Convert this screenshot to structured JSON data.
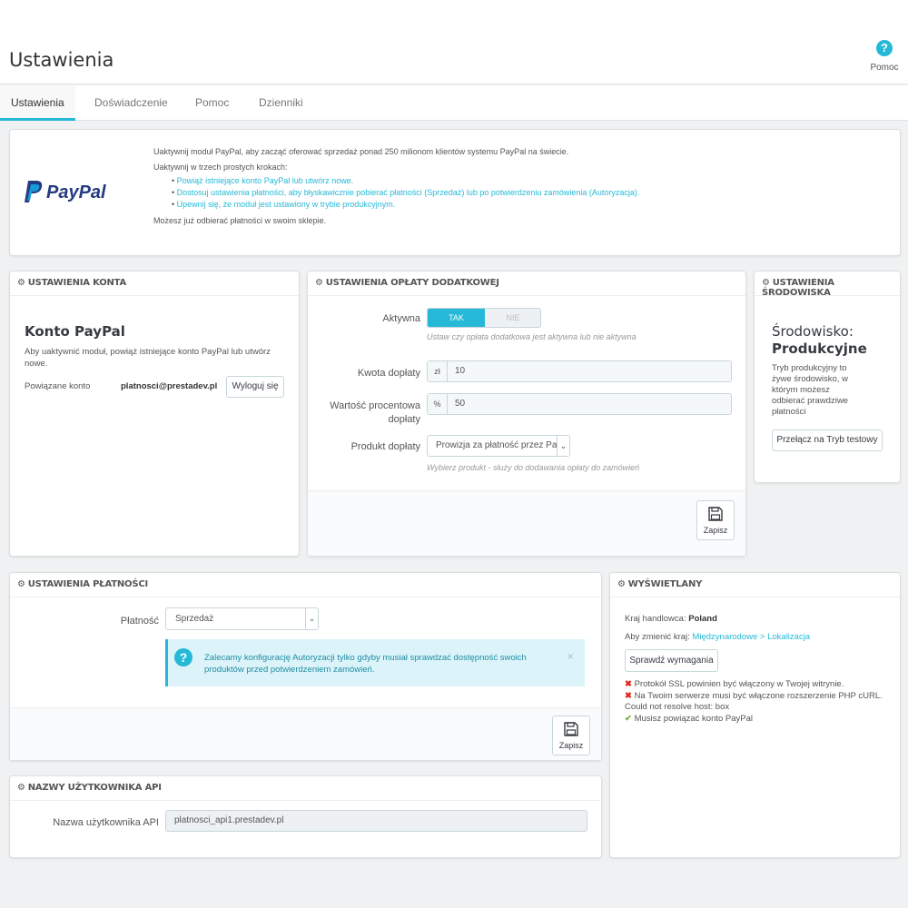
{
  "header": {
    "title": "Ustawienia",
    "help_label": "Pomoc",
    "help_icon": "question-circle-icon"
  },
  "tabs": [
    {
      "label": "Ustawienia",
      "active": true
    },
    {
      "label": "Doświadczenie"
    },
    {
      "label": "Pomoc"
    },
    {
      "label": "Dzienniki"
    }
  ],
  "intro": {
    "logo_text": "PayPal",
    "line1": "Uaktywnij moduł PayPal, aby zacząć oferować sprzedaż ponad 250 milionom klientów systemu PayPal na świecie.",
    "line2": "Uaktywnij w trzech prostych krokach:",
    "steps": [
      "Powiąż istniejące konto PayPal lub utwórz nowe.",
      "Dostosuj ustawienia płatności, aby błyskawicznie pobierać płatności (Sprzedaż) lub po potwierdzeniu zamówienia (Autoryzacja).",
      "Upewnij się, że moduł jest ustawiony w trybie produkcyjnym."
    ],
    "line3": "Możesz już odbierać płatności w swoim sklepie."
  },
  "account": {
    "heading": "USTAWIENIA KONTA",
    "title": "Konto PayPal",
    "desc": "Aby uaktywnić moduł, powiąż istniejące konto PayPal lub utwórz nowe.",
    "linked_label": "Powiązane konto",
    "linked_email": "platnosci@prestadev.pl",
    "logout_label": "Wyloguj się"
  },
  "fee": {
    "heading": "USTAWIENIA OPŁATY DODATKOWEJ",
    "active_label": "Aktywna",
    "toggle_yes": "TAK",
    "toggle_no": "NIE",
    "active_help": "Ustaw czy opłata dodatkowa jest aktywna lub nie aktywna",
    "amount_label": "Kwota dopłaty",
    "amount_addon": "zł",
    "amount_value": "10",
    "percent_label_1": "Wartość procentowa",
    "percent_label_2": "dopłaty",
    "percent_addon": "%",
    "percent_value": "50",
    "product_label": "Produkt dopłaty",
    "product_value": "Prowizja za płatność przez Pay",
    "product_help": "Wybierz produkt - służy do dodawania opłaty do zamówień",
    "save_label": "Zapisz"
  },
  "env": {
    "heading": "USTAWIENIA ŚRODOWISKA",
    "title_1": "Środowisko:",
    "title_2": "Produkcyjne",
    "desc_lines": [
      "Tryb produkcyjny to",
      "żywe środowisko, w",
      "którym możesz",
      "odbierać prawdziwe",
      "płatności"
    ],
    "switch_label": "Przełącz na Tryb testowy"
  },
  "payment": {
    "heading": "USTAWIENIA PŁATNOŚCI",
    "label": "Płatność",
    "value": "Sprzedaż",
    "alert_line1": "Zalecamy konfigurację Autoryzacji tylko gdyby musiał sprawdzać dostępność swoich",
    "alert_line2": "produktów przed potwierdzeniem zamówień.",
    "alert_close": "×",
    "save_label": "Zapisz"
  },
  "display": {
    "heading": "WYŚWIETLANY",
    "country_label": "Kraj handlowca:",
    "country_value": "Poland",
    "change_label": "Aby zmienić kraj:",
    "change_link": "Międzynarodowe > Lokalizacja",
    "check_button": "Sprawdź wymagania",
    "requirements": [
      {
        "status": "error",
        "text": "Protokół SSL powinien być włączony w Twojej witrynie."
      },
      {
        "status": "error",
        "text": "Na Twoim serwerze musi być włączone rozszerzenie PHP cURL."
      },
      {
        "status": "none",
        "text": "Could not resolve host: box"
      },
      {
        "status": "ok",
        "text": "Musisz powiązać konto PayPal"
      }
    ]
  },
  "api": {
    "heading": "NAZWY UŻYTKOWNIKA API",
    "label": "Nazwa użytkownika API",
    "value": "platnosci_api1.prestadev.pl"
  },
  "colors": {
    "accent": "#25b9d7",
    "error": "#e0281e",
    "success": "#72b433",
    "paypal_dark": "#253b80",
    "paypal_light": "#179bd7"
  }
}
